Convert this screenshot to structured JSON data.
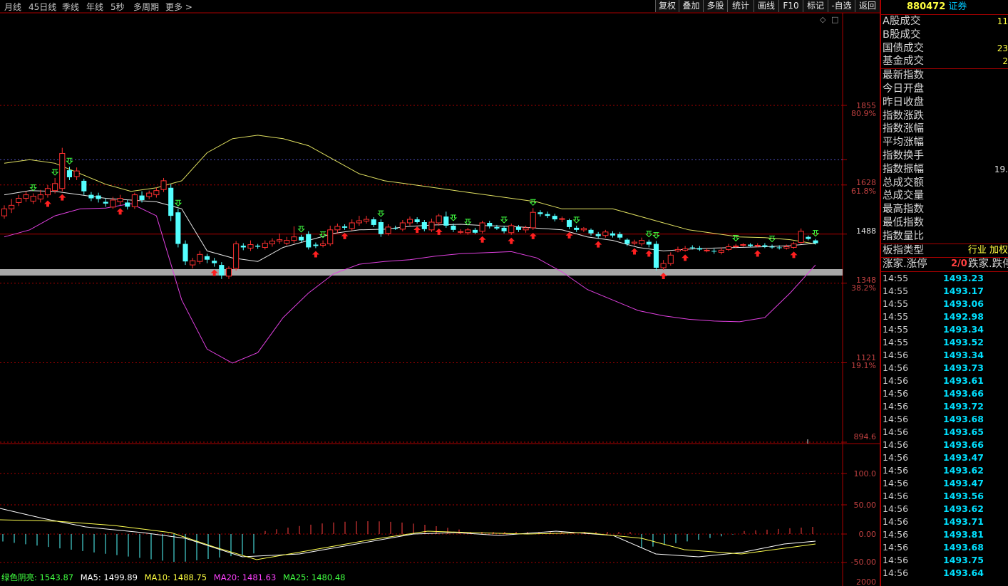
{
  "toolbar": {
    "periods": [
      "月线",
      "45日线",
      "季线",
      "年线",
      "5秒",
      "多周期",
      "更多"
    ],
    "buttons": [
      "复权",
      "叠加",
      "多股",
      "统计",
      "画线",
      "F10",
      "标记",
      "-自选",
      "返回"
    ]
  },
  "price_axis": [
    {
      "value": "1855",
      "pct": "80.9%"
    },
    {
      "value": "1628",
      "pct": "61.8%"
    },
    {
      "value": "1488",
      "pct": ""
    },
    {
      "value": "1348",
      "pct": "38.2%"
    },
    {
      "value": "1121",
      "pct": "19.1%"
    },
    {
      "value": "894.6",
      "pct": ""
    }
  ],
  "indicator_axis": [
    "100.0",
    "50.00",
    "0.00",
    "-50.00",
    "2000"
  ],
  "legend": {
    "green_shadow": "绿色阴亮: 1543.87",
    "ma5": "MA5: 1499.89",
    "ma10": "MA10: 1488.75",
    "ma20": "MA20: 1481.63",
    "ma25": "MA25: 1480.48"
  },
  "colors": {
    "up": "#ff3030",
    "down": "#54ffff",
    "upper_band": "#e0e060",
    "mid_band": "#e6e6e6",
    "lower_band": "#e040e0",
    "panel_border": "#aa0000"
  },
  "stock": {
    "code": "880472",
    "name": "证券"
  },
  "volume_section": [
    {
      "label": "A股成交",
      "value": "11"
    },
    {
      "label": "B股成交",
      "value": ""
    },
    {
      "label": "国债成交",
      "value": "23"
    },
    {
      "label": "基金成交",
      "value": "2"
    }
  ],
  "index_section": [
    {
      "label": "最新指数",
      "value": ""
    },
    {
      "label": "今日开盘",
      "value": ""
    },
    {
      "label": "昨日收盘",
      "value": ""
    },
    {
      "label": "指数涨跌",
      "value": ""
    },
    {
      "label": "指数涨幅",
      "value": ""
    },
    {
      "label": "平均涨幅",
      "value": ""
    },
    {
      "label": "指数换手",
      "value": ""
    },
    {
      "label": "指数振幅",
      "value": "19."
    },
    {
      "label": "总成交额",
      "value": ""
    },
    {
      "label": "总成交量",
      "value": ""
    },
    {
      "label": "最高指数",
      "value": ""
    },
    {
      "label": "最低指数",
      "value": ""
    },
    {
      "label": "指数量比",
      "value": ""
    }
  ],
  "board_type": {
    "label": "板指类型",
    "value": "行业 加权"
  },
  "rise_fall": {
    "label": "涨家.涨停",
    "value": "2/0",
    "label2": "跌家.跌停"
  },
  "ticks": [
    {
      "time": "14:55",
      "price": "1493.23"
    },
    {
      "time": "14:55",
      "price": "1493.17"
    },
    {
      "time": "14:55",
      "price": "1493.06"
    },
    {
      "time": "14:55",
      "price": "1492.98"
    },
    {
      "time": "14:55",
      "price": "1493.34"
    },
    {
      "time": "14:55",
      "price": "1493.52"
    },
    {
      "time": "14:56",
      "price": "1493.34"
    },
    {
      "time": "14:56",
      "price": "1493.73"
    },
    {
      "time": "14:56",
      "price": "1493.61"
    },
    {
      "time": "14:56",
      "price": "1493.66"
    },
    {
      "time": "14:56",
      "price": "1493.72"
    },
    {
      "time": "14:56",
      "price": "1493.68"
    },
    {
      "time": "14:56",
      "price": "1493.65"
    },
    {
      "time": "14:56",
      "price": "1493.66"
    },
    {
      "time": "14:56",
      "price": "1493.47"
    },
    {
      "time": "14:56",
      "price": "1493.62"
    },
    {
      "time": "14:56",
      "price": "1493.47"
    },
    {
      "time": "14:56",
      "price": "1493.56"
    },
    {
      "time": "14:56",
      "price": "1493.62"
    },
    {
      "time": "14:56",
      "price": "1493.71"
    },
    {
      "time": "14:56",
      "price": "1493.81"
    },
    {
      "time": "14:56",
      "price": "1493.68"
    },
    {
      "time": "14:56",
      "price": "1493.75"
    },
    {
      "time": "14:56",
      "price": "1493.64"
    }
  ],
  "chart_data": {
    "type": "candlestick",
    "ylim": [
      894.6,
      1966
    ],
    "candles": [
      [
        1540,
        1560,
        1532,
        1570
      ],
      [
        1560,
        1570,
        1548,
        1588
      ],
      [
        1578,
        1590,
        1568,
        1600
      ],
      [
        1590,
        1600,
        1580,
        1610
      ],
      [
        1582,
        1596,
        1574,
        1604
      ],
      [
        1588,
        1600,
        1578,
        1614
      ],
      [
        1600,
        1618,
        1592,
        1628
      ],
      [
        1612,
        1632,
        1604,
        1648
      ],
      [
        1618,
        1718,
        1610,
        1734
      ],
      [
        1670,
        1650,
        1642,
        1680
      ],
      [
        1652,
        1668,
        1642,
        1678
      ],
      [
        1640,
        1610,
        1600,
        1646
      ],
      [
        1600,
        1590,
        1582,
        1608
      ],
      [
        1598,
        1588,
        1578,
        1606
      ],
      [
        1580,
        1575,
        1566,
        1590
      ],
      [
        1565,
        1585,
        1560,
        1594
      ],
      [
        1580,
        1590,
        1570,
        1600
      ],
      [
        1578,
        1566,
        1558,
        1586
      ],
      [
        1566,
        1600,
        1560,
        1606
      ],
      [
        1598,
        1585,
        1578,
        1610
      ],
      [
        1595,
        1605,
        1588,
        1612
      ],
      [
        1600,
        1612,
        1592,
        1620
      ],
      [
        1615,
        1640,
        1608,
        1648
      ],
      [
        1620,
        1540,
        1525,
        1630
      ],
      [
        1550,
        1460,
        1450,
        1560
      ],
      [
        1460,
        1410,
        1400,
        1470
      ],
      [
        1400,
        1412,
        1390,
        1420
      ],
      [
        1410,
        1430,
        1402,
        1440
      ],
      [
        1425,
        1415,
        1405,
        1432
      ],
      [
        1412,
        1405,
        1395,
        1420
      ],
      [
        1400,
        1370,
        1360,
        1408
      ],
      [
        1368,
        1390,
        1360,
        1396
      ],
      [
        1390,
        1460,
        1384,
        1468
      ],
      [
        1455,
        1450,
        1442,
        1462
      ],
      [
        1448,
        1458,
        1440,
        1470
      ],
      [
        1455,
        1452,
        1446,
        1460
      ],
      [
        1450,
        1462,
        1444,
        1470
      ],
      [
        1460,
        1468,
        1452,
        1476
      ],
      [
        1468,
        1472,
        1460,
        1490
      ],
      [
        1462,
        1470,
        1456,
        1480
      ],
      [
        1470,
        1480,
        1462,
        1510
      ],
      [
        1480,
        1470,
        1464,
        1486
      ],
      [
        1488,
        1450,
        1444,
        1496
      ],
      [
        1458,
        1454,
        1448,
        1464
      ],
      [
        1456,
        1460,
        1450,
        1470
      ],
      [
        1460,
        1500,
        1454,
        1512
      ],
      [
        1500,
        1510,
        1492,
        1518
      ],
      [
        1510,
        1506,
        1500,
        1516
      ],
      [
        1504,
        1520,
        1498,
        1530
      ],
      [
        1520,
        1526,
        1512,
        1540
      ],
      [
        1525,
        1530,
        1518,
        1540
      ],
      [
        1530,
        1514,
        1508,
        1536
      ],
      [
        1522,
        1488,
        1480,
        1530
      ],
      [
        1490,
        1508,
        1484,
        1516
      ],
      [
        1505,
        1504,
        1500,
        1512
      ],
      [
        1502,
        1520,
        1496,
        1528
      ],
      [
        1520,
        1530,
        1512,
        1538
      ],
      [
        1530,
        1522,
        1518,
        1536
      ],
      [
        1522,
        1502,
        1496,
        1528
      ],
      [
        1500,
        1522,
        1494,
        1532
      ],
      [
        1520,
        1540,
        1512,
        1546
      ],
      [
        1538,
        1512,
        1506,
        1552
      ],
      [
        1512,
        1500,
        1494,
        1518
      ],
      [
        1495,
        1495,
        1488,
        1502
      ],
      [
        1492,
        1500,
        1486,
        1506
      ],
      [
        1500,
        1492,
        1488,
        1506
      ],
      [
        1496,
        1520,
        1490,
        1526
      ],
      [
        1520,
        1510,
        1504,
        1526
      ],
      [
        1508,
        1504,
        1500,
        1514
      ],
      [
        1506,
        1496,
        1490,
        1512
      ],
      [
        1492,
        1512,
        1486,
        1518
      ],
      [
        1508,
        1500,
        1494,
        1514
      ],
      [
        1500,
        1506,
        1492,
        1512
      ],
      [
        1506,
        1550,
        1500,
        1562
      ],
      [
        1550,
        1545,
        1538,
        1556
      ],
      [
        1545,
        1540,
        1534,
        1552
      ],
      [
        1540,
        1530,
        1524,
        1546
      ],
      [
        1530,
        1532,
        1522,
        1538
      ],
      [
        1528,
        1508,
        1502,
        1532
      ],
      [
        1506,
        1500,
        1494,
        1512
      ],
      [
        1500,
        1504,
        1494,
        1508
      ],
      [
        1500,
        1490,
        1484,
        1504
      ],
      [
        1488,
        1482,
        1476,
        1494
      ],
      [
        1484,
        1494,
        1478,
        1500
      ],
      [
        1490,
        1484,
        1478,
        1496
      ],
      [
        1488,
        1478,
        1472,
        1494
      ],
      [
        1472,
        1460,
        1454,
        1476
      ],
      [
        1462,
        1465,
        1456,
        1472
      ],
      [
        1460,
        1470,
        1454,
        1478
      ],
      [
        1466,
        1458,
        1450,
        1472
      ],
      [
        1460,
        1392,
        1384,
        1468
      ],
      [
        1392,
        1404,
        1386,
        1414
      ],
      [
        1404,
        1428,
        1398,
        1436
      ],
      [
        1440,
        1444,
        1436,
        1452
      ],
      [
        1442,
        1446,
        1438,
        1454
      ],
      [
        1450,
        1448,
        1444,
        1456
      ],
      [
        1448,
        1444,
        1440,
        1454
      ],
      [
        1440,
        1442,
        1436,
        1448
      ],
      [
        1440,
        1438,
        1432,
        1446
      ],
      [
        1436,
        1442,
        1430,
        1450
      ],
      [
        1444,
        1452,
        1440,
        1460
      ],
      [
        1452,
        1454,
        1448,
        1460
      ],
      [
        1456,
        1458,
        1452,
        1462
      ],
      [
        1458,
        1454,
        1450,
        1462
      ],
      [
        1454,
        1456,
        1450,
        1462
      ],
      [
        1456,
        1452,
        1448,
        1462
      ],
      [
        1452,
        1450,
        1446,
        1458
      ],
      [
        1450,
        1448,
        1444,
        1456
      ],
      [
        1448,
        1452,
        1444,
        1458
      ],
      [
        1450,
        1460,
        1446,
        1466
      ],
      [
        1464,
        1496,
        1460,
        1504
      ],
      [
        1480,
        1474,
        1470,
        1484
      ],
      [
        1470,
        1462,
        1458,
        1474
      ]
    ],
    "upper_band": [
      1690,
      1700,
      1690,
      1660,
      1630,
      1610,
      1620,
      1640,
      1720,
      1760,
      1770,
      1760,
      1740,
      1700,
      1660,
      1640,
      1630,
      1620,
      1610,
      1600,
      1590,
      1580,
      1560,
      1560,
      1560,
      1540,
      1520,
      1500,
      1490,
      1480,
      1478,
      1472,
      1460
    ],
    "mid_band": [
      1600,
      1612,
      1610,
      1600,
      1590,
      1585,
      1580,
      1560,
      1440,
      1420,
      1410,
      1450,
      1470,
      1490,
      1500,
      1502,
      1510,
      1514,
      1516,
      1512,
      1510,
      1505,
      1500,
      1480,
      1470,
      1450,
      1440,
      1445,
      1448,
      1450,
      1452,
      1455,
      1462
    ],
    "lower_band": [
      1480,
      1500,
      1540,
      1560,
      1562,
      1575,
      1540,
      1300,
      1160,
      1120,
      1150,
      1250,
      1320,
      1375,
      1402,
      1410,
      1415,
      1425,
      1432,
      1435,
      1438,
      1420,
      1380,
      1330,
      1300,
      1270,
      1255,
      1245,
      1240,
      1238,
      1250,
      1320,
      1400
    ],
    "ref_lines": [
      1855,
      1700,
      1628,
      1488,
      1348,
      1121,
      894.6
    ]
  }
}
